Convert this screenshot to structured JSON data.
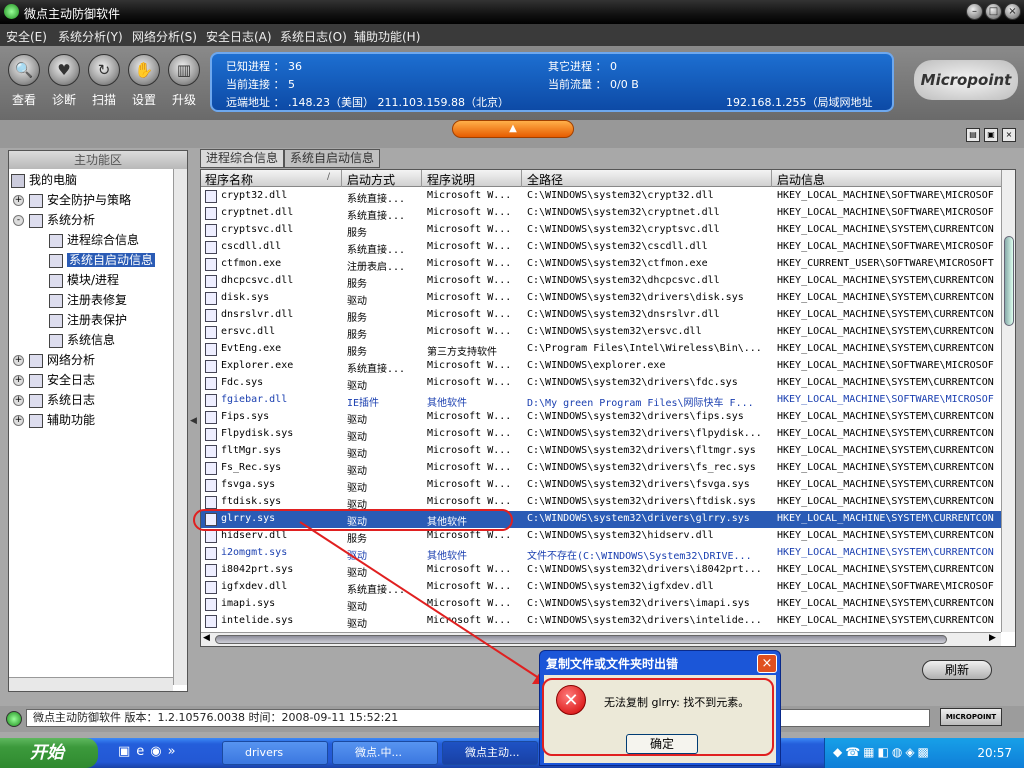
{
  "app": {
    "title": "微点主动防御软件"
  },
  "menu": [
    "安全(E)",
    "系统分析(Y)",
    "网络分析(S)",
    "安全日志(A)",
    "系统日志(O)",
    "辅助功能(H)"
  ],
  "toolbar": [
    {
      "label": "查看",
      "icon": "magnifier-icon"
    },
    {
      "label": "诊断",
      "icon": "heart-icon"
    },
    {
      "label": "扫描",
      "icon": "scan-icon"
    },
    {
      "label": "设置",
      "icon": "hand-icon"
    },
    {
      "label": "升级",
      "icon": "tower-icon"
    }
  ],
  "status": {
    "known_proc": "已知进程 ： 36",
    "other_proc": "其它进程 ： 0",
    "cur_conn": "当前连接 ： 5",
    "cur_flow": "当前流量 ： 0/0 B",
    "remote": "远端地址 ：  .148.23（美国）    211.103.159.88（北京）",
    "remote2": "192.168.1.255（局域网地址",
    "logo": "Micropoint"
  },
  "left": {
    "header": "主功能区",
    "root": "我的电脑",
    "items": [
      {
        "label": "安全防护与策略",
        "level": 1,
        "exp": "+"
      },
      {
        "label": "系统分析",
        "level": 1,
        "exp": "-"
      },
      {
        "label": "进程综合信息",
        "level": 2
      },
      {
        "label": "系统自启动信息",
        "level": 2,
        "selected": true
      },
      {
        "label": "模块/进程",
        "level": 2
      },
      {
        "label": "注册表修复",
        "level": 2
      },
      {
        "label": "注册表保护",
        "level": 2
      },
      {
        "label": "系统信息",
        "level": 2
      },
      {
        "label": "网络分析",
        "level": 1,
        "exp": "+"
      },
      {
        "label": "安全日志",
        "level": 1,
        "exp": "+"
      },
      {
        "label": "系统日志",
        "level": 1,
        "exp": "+"
      },
      {
        "label": "辅助功能",
        "level": 1,
        "exp": "+"
      }
    ]
  },
  "tabs": [
    "进程综合信息",
    "系统自启动信息"
  ],
  "grid": {
    "columns": [
      "程序名称",
      "启动方式",
      "程序说明",
      "全路径",
      "启动信息"
    ],
    "rows": [
      [
        "crypt32.dll",
        "系统直接...",
        "Microsoft W...",
        "C:\\WINDOWS\\system32\\crypt32.dll",
        "HKEY_LOCAL_MACHINE\\SOFTWARE\\MICROSOF"
      ],
      [
        "cryptnet.dll",
        "系统直接...",
        "Microsoft W...",
        "C:\\WINDOWS\\system32\\cryptnet.dll",
        "HKEY_LOCAL_MACHINE\\SOFTWARE\\MICROSOF"
      ],
      [
        "cryptsvc.dll",
        "服务",
        "Microsoft W...",
        "C:\\WINDOWS\\system32\\cryptsvc.dll",
        "HKEY_LOCAL_MACHINE\\SYSTEM\\CURRENTCON"
      ],
      [
        "cscdll.dll",
        "系统直接...",
        "Microsoft W...",
        "C:\\WINDOWS\\system32\\cscdll.dll",
        "HKEY_LOCAL_MACHINE\\SOFTWARE\\MICROSOF"
      ],
      [
        "ctfmon.exe",
        "注册表启...",
        "Microsoft W...",
        "C:\\WINDOWS\\system32\\ctfmon.exe",
        "HKEY_CURRENT_USER\\SOFTWARE\\MICROSOFT"
      ],
      [
        "dhcpcsvc.dll",
        "服务",
        "Microsoft W...",
        "C:\\WINDOWS\\system32\\dhcpcsvc.dll",
        "HKEY_LOCAL_MACHINE\\SYSTEM\\CURRENTCON"
      ],
      [
        "disk.sys",
        "驱动",
        "Microsoft W...",
        "C:\\WINDOWS\\system32\\drivers\\disk.sys",
        "HKEY_LOCAL_MACHINE\\SYSTEM\\CURRENTCON"
      ],
      [
        "dnsrslvr.dll",
        "服务",
        "Microsoft W...",
        "C:\\WINDOWS\\system32\\dnsrslvr.dll",
        "HKEY_LOCAL_MACHINE\\SYSTEM\\CURRENTCON"
      ],
      [
        "ersvc.dll",
        "服务",
        "Microsoft W...",
        "C:\\WINDOWS\\system32\\ersvc.dll",
        "HKEY_LOCAL_MACHINE\\SYSTEM\\CURRENTCON"
      ],
      [
        "EvtEng.exe",
        "服务",
        "第三方支持软件",
        "C:\\Program Files\\Intel\\Wireless\\Bin\\...",
        "HKEY_LOCAL_MACHINE\\SYSTEM\\CURRENTCON"
      ],
      [
        "Explorer.exe",
        "系统直接...",
        "Microsoft W...",
        "C:\\WINDOWS\\explorer.exe",
        "HKEY_LOCAL_MACHINE\\SOFTWARE\\MICROSOF"
      ],
      [
        "Fdc.sys",
        "驱动",
        "Microsoft W...",
        "C:\\WINDOWS\\system32\\drivers\\fdc.sys",
        "HKEY_LOCAL_MACHINE\\SYSTEM\\CURRENTCON"
      ],
      [
        "fgiebar.dll",
        "IE插件",
        "其他软件",
        "D:\\My green Program Files\\网际快车 F...",
        "HKEY_LOCAL_MACHINE\\SOFTWARE\\MICROSOF",
        "blue"
      ],
      [
        "Fips.sys",
        "驱动",
        "Microsoft W...",
        "C:\\WINDOWS\\system32\\drivers\\fips.sys",
        "HKEY_LOCAL_MACHINE\\SYSTEM\\CURRENTCON"
      ],
      [
        "Flpydisk.sys",
        "驱动",
        "Microsoft W...",
        "C:\\WINDOWS\\system32\\drivers\\flpydisk...",
        "HKEY_LOCAL_MACHINE\\SYSTEM\\CURRENTCON"
      ],
      [
        "fltMgr.sys",
        "驱动",
        "Microsoft W...",
        "C:\\WINDOWS\\system32\\drivers\\fltmgr.sys",
        "HKEY_LOCAL_MACHINE\\SYSTEM\\CURRENTCON"
      ],
      [
        "Fs_Rec.sys",
        "驱动",
        "Microsoft W...",
        "C:\\WINDOWS\\system32\\drivers\\fs_rec.sys",
        "HKEY_LOCAL_MACHINE\\SYSTEM\\CURRENTCON"
      ],
      [
        "fsvga.sys",
        "驱动",
        "Microsoft W...",
        "C:\\WINDOWS\\system32\\drivers\\fsvga.sys",
        "HKEY_LOCAL_MACHINE\\SYSTEM\\CURRENTCON"
      ],
      [
        "ftdisk.sys",
        "驱动",
        "Microsoft W...",
        "C:\\WINDOWS\\system32\\drivers\\ftdisk.sys",
        "HKEY_LOCAL_MACHINE\\SYSTEM\\CURRENTCON"
      ],
      [
        "glrry.sys",
        "驱动",
        "其他软件",
        "C:\\WINDOWS\\system32\\drivers\\glrry.sys",
        "HKEY_LOCAL_MACHINE\\SYSTEM\\CURRENTCON",
        "selected"
      ],
      [
        "hidserv.dll",
        "服务",
        "Microsoft W...",
        "C:\\WINDOWS\\system32\\hidserv.dll",
        "HKEY_LOCAL_MACHINE\\SYSTEM\\CURRENTCON"
      ],
      [
        "i2omgmt.sys",
        "驱动",
        "其他软件",
        "文件不存在(C:\\WINDOWS\\System32\\DRIVE...",
        "HKEY_LOCAL_MACHINE\\SYSTEM\\CURRENTCON",
        "blue"
      ],
      [
        "i8042prt.sys",
        "驱动",
        "Microsoft W...",
        "C:\\WINDOWS\\system32\\drivers\\i8042prt...",
        "HKEY_LOCAL_MACHINE\\SYSTEM\\CURRENTCON"
      ],
      [
        "igfxdev.dll",
        "系统直接...",
        "Microsoft W...",
        "C:\\WINDOWS\\system32\\igfxdev.dll",
        "HKEY_LOCAL_MACHINE\\SOFTWARE\\MICROSOF"
      ],
      [
        "imapi.sys",
        "驱动",
        "Microsoft W...",
        "C:\\WINDOWS\\system32\\drivers\\imapi.sys",
        "HKEY_LOCAL_MACHINE\\SYSTEM\\CURRENTCON"
      ],
      [
        "intelide.sys",
        "驱动",
        "Microsoft W...",
        "C:\\WINDOWS\\system32\\drivers\\intelide...",
        "HKEY_LOCAL_MACHINE\\SYSTEM\\CURRENTCON"
      ]
    ]
  },
  "refresh_label": "刷新",
  "statusbar": {
    "text": "微点主动防御软件    版本：1.2.10576.0038    时间：2008-09-11 15:52:21",
    "badge": "MICROPOINT"
  },
  "dialog": {
    "title": "复制文件或文件夹时出错",
    "message": "无法复制 glrry: 找不到元素。",
    "ok": "确定"
  },
  "taskbar": {
    "start": "开始",
    "tasks": [
      "drivers",
      "微点.中...",
      "微点主动..."
    ],
    "clock": "20:57"
  }
}
